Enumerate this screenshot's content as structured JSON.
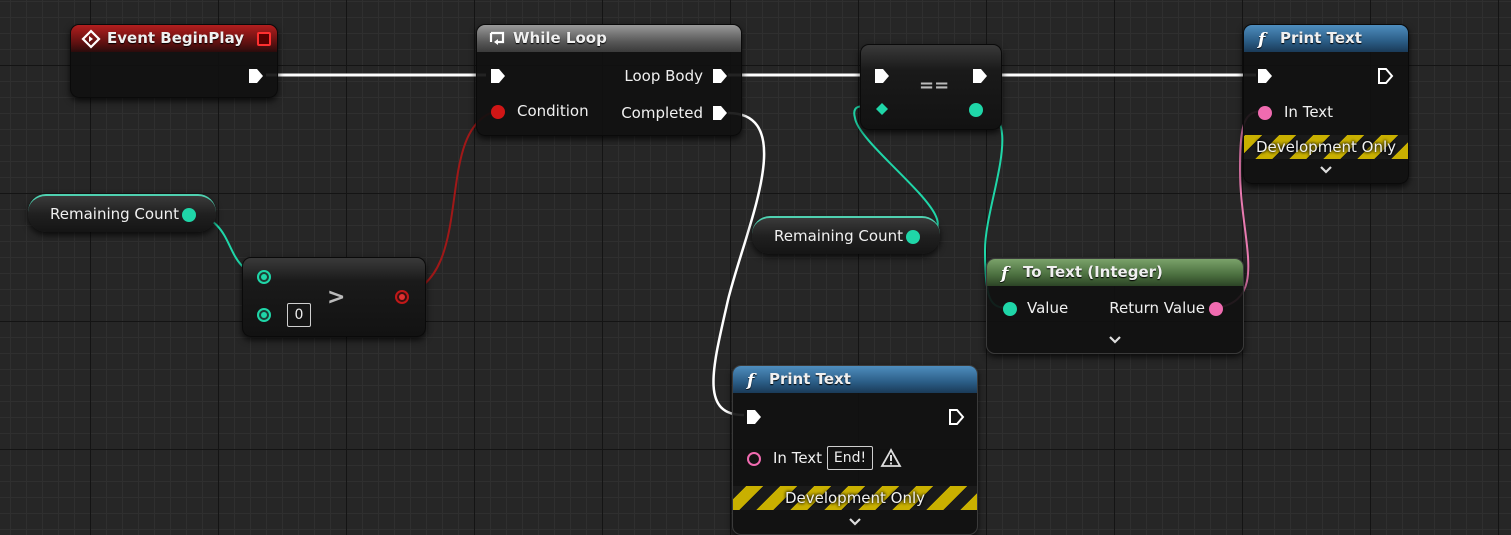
{
  "nodes": {
    "event_begin_play": {
      "title": "Event BeginPlay"
    },
    "while_loop": {
      "title": "While Loop",
      "condition": "Condition",
      "loop_body": "Loop Body",
      "completed": "Completed"
    },
    "equals": {
      "symbol": "=="
    },
    "print_text_top": {
      "title": "Print Text",
      "in_text": "In Text",
      "dev_only": "Development Only"
    },
    "remaining_count_left": {
      "label": "Remaining Count"
    },
    "greater": {
      "symbol": ">",
      "default_value": "0"
    },
    "remaining_count_mid": {
      "label": "Remaining Count"
    },
    "to_text": {
      "title": "To Text (Integer)",
      "value": "Value",
      "return_value": "Return Value"
    },
    "print_text_bottom": {
      "title": "Print Text",
      "in_text": "In Text",
      "in_text_value": "End!",
      "dev_only": "Development Only"
    }
  },
  "colors": {
    "exec_wire": "#ffffff",
    "int_wire": "#1fd6a8",
    "bool_wire": "#a01818",
    "text_wire": "#e87ab0"
  },
  "icons": [
    "event-icon",
    "loop-icon",
    "function-icon",
    "warning-icon",
    "chevron-down-icon"
  ]
}
